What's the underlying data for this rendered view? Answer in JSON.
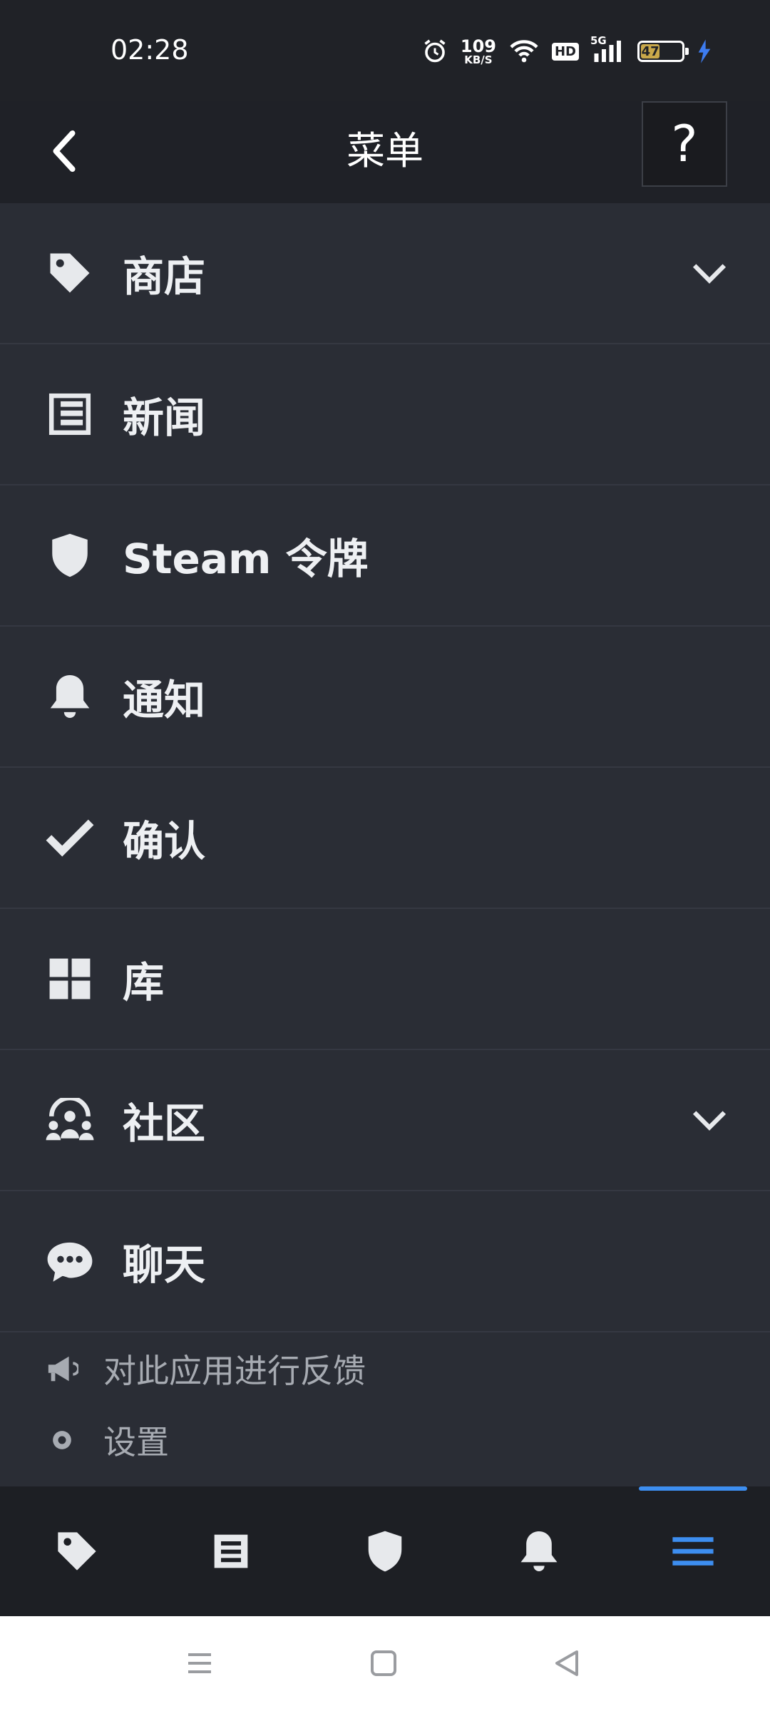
{
  "status_bar": {
    "time": "02:28",
    "net_speed_value": "109",
    "net_speed_unit": "KB/S",
    "hd_label": "HD",
    "network_type": "5G",
    "battery_level": "47",
    "battery_fraction": 0.47,
    "icons": [
      "alarm-icon",
      "wifi-icon",
      "hd-icon",
      "signal-icon",
      "battery-icon",
      "charging-icon"
    ]
  },
  "header": {
    "title": "菜单",
    "help_label": "?"
  },
  "menu": {
    "items": [
      {
        "label": "商店",
        "icon": "tag-icon",
        "expandable": true
      },
      {
        "label": "新闻",
        "icon": "news-icon",
        "expandable": false
      },
      {
        "label": "Steam 令牌",
        "icon": "shield-icon",
        "expandable": false
      },
      {
        "label": "通知",
        "icon": "bell-icon",
        "expandable": false
      },
      {
        "label": "确认",
        "icon": "checkmark-icon",
        "expandable": false
      },
      {
        "label": "库",
        "icon": "grid-icon",
        "expandable": false
      },
      {
        "label": "社区",
        "icon": "community-icon",
        "expandable": true
      },
      {
        "label": "聊天",
        "icon": "chat-icon",
        "expandable": false
      }
    ],
    "secondary": [
      {
        "label": "对此应用进行反馈",
        "icon": "megaphone-icon"
      },
      {
        "label": "设置",
        "icon": "gear-icon"
      }
    ]
  },
  "bottom_nav": {
    "tabs": [
      "tag-icon",
      "news-icon",
      "shield-icon",
      "bell-icon",
      "menu-icon"
    ],
    "active_tab": "menu-icon",
    "accent_color": "#3d8ef0"
  },
  "colors": {
    "menu_background": "#2a2d35",
    "header_background": "#1f2127",
    "text_primary": "#eef0f3",
    "text_secondary": "#a7abb2"
  }
}
